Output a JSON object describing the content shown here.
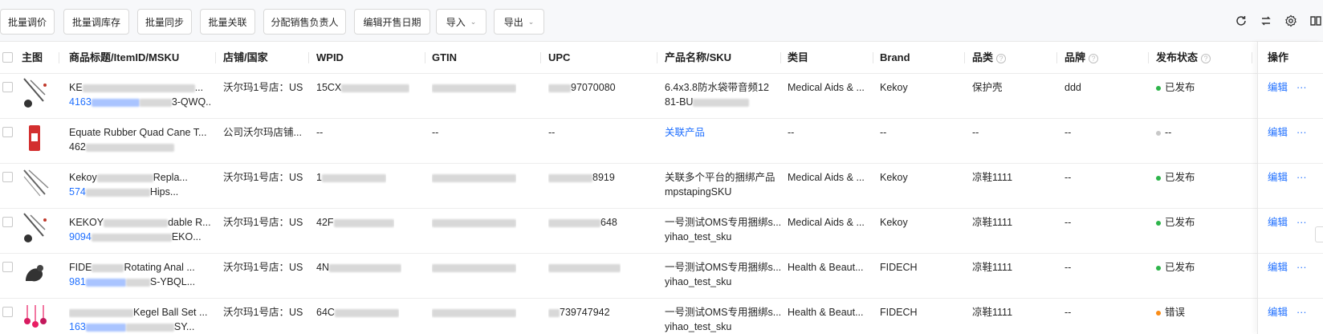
{
  "toolbar": {
    "buttons": [
      {
        "label": "批量调价"
      },
      {
        "label": "批量调库存"
      },
      {
        "label": "批量同步"
      },
      {
        "label": "批量关联"
      },
      {
        "label": "分配销售负责人"
      },
      {
        "label": "编辑开售日期"
      },
      {
        "label": "导入"
      },
      {
        "label": "导出"
      }
    ],
    "icons": [
      "refresh-icon",
      "switch-icon",
      "settings-icon",
      "book-icon"
    ]
  },
  "table": {
    "headers": {
      "main_image": "主图",
      "title": "商品标题/ItemID/MSKU",
      "store": "店铺/国家",
      "wpid": "WPID",
      "gtin": "GTIN",
      "upc": "UPC",
      "product": "产品名称/SKU",
      "category": "类目",
      "brand_en": "Brand",
      "category_cn": "品类",
      "brand_cn": "品牌",
      "status": "发布状态",
      "ops": "操作"
    },
    "rows": [
      {
        "title1": "KE",
        "title1_tail": "...",
        "title2": "4163",
        "title2_tail": "3-QWQ...",
        "store": "沃尔玛1号店：US",
        "wpid": "15CX",
        "gtin": "",
        "upc": "97070080",
        "product1": "6.4x3.8防水袋带音频12",
        "product2": "81-BU",
        "category": "Medical Aids & ...",
        "brand_en": "Kekoy",
        "category_cn": "保护壳",
        "brand_cn": "ddd",
        "status": "已发布",
        "status_color": "#2db44a",
        "op_edit": "编辑",
        "op_more": "···"
      },
      {
        "title1": "Equate Rubber Quad Cane T...",
        "title1_tail": "",
        "title2": "462",
        "title2_tail": "",
        "store": "公司沃尔玛店铺...",
        "wpid": "--",
        "gtin": "--",
        "upc": "--",
        "product1": "关联产品",
        "product2": "",
        "category": "--",
        "brand_en": "--",
        "category_cn": "--",
        "brand_cn": "--",
        "status": "--",
        "status_color": "#c8c8c8",
        "op_edit": "编辑",
        "op_more": "···"
      },
      {
        "title1": "Kekoy",
        "title1_tail": "Repla...",
        "title2": "574",
        "title2_tail": "Hips...",
        "store": "沃尔玛1号店：US",
        "wpid": "1",
        "gtin": "",
        "upc": "8919",
        "product1": "关联多个平台的捆绑产品",
        "product2": "mpstapingSKU",
        "category": "Medical Aids & ...",
        "brand_en": "Kekoy",
        "category_cn": "凉鞋1111",
        "brand_cn": "--",
        "status": "已发布",
        "status_color": "#2db44a",
        "op_edit": "编辑",
        "op_more": "···"
      },
      {
        "title1": "KEKOY",
        "title1_tail": "dable R...",
        "title2": "9094",
        "title2_tail": "EKO...",
        "store": "沃尔玛1号店：US",
        "wpid": "42F",
        "gtin": "",
        "upc": "648",
        "product1": "一号测试OMS专用捆绑s...",
        "product2": "yihao_test_sku",
        "category": "Medical Aids & ...",
        "brand_en": "Kekoy",
        "category_cn": "凉鞋1111",
        "brand_cn": "--",
        "status": "已发布",
        "status_color": "#2db44a",
        "op_edit": "编辑",
        "op_more": "···"
      },
      {
        "title1": "FIDE",
        "title1_tail": "Rotating Anal ...",
        "title2": "981",
        "title2_tail": "S-YBQL...",
        "store": "沃尔玛1号店：US",
        "wpid": "4N",
        "gtin": "",
        "upc": "",
        "product1": "一号测试OMS专用捆绑s...",
        "product2": "yihao_test_sku",
        "category": "Health & Beaut...",
        "brand_en": "FIDECH",
        "category_cn": "凉鞋1111",
        "brand_cn": "--",
        "status": "已发布",
        "status_color": "#2db44a",
        "op_edit": "编辑",
        "op_more": "···"
      },
      {
        "title1": "",
        "title1_tail": "Kegel Ball Set ...",
        "title2": "163",
        "title2_tail": "SY...",
        "store": "沃尔玛1号店：US",
        "wpid": "64C",
        "gtin": "",
        "upc": "739747942",
        "product1": "一号测试OMS专用捆绑s...",
        "product2": "yihao_test_sku",
        "category": "Health & Beaut...",
        "brand_en": "FIDECH",
        "category_cn": "凉鞋1111",
        "brand_cn": "--",
        "status": "错误",
        "status_color": "#fa8c16",
        "op_edit": "编辑",
        "op_more": "···"
      }
    ]
  }
}
